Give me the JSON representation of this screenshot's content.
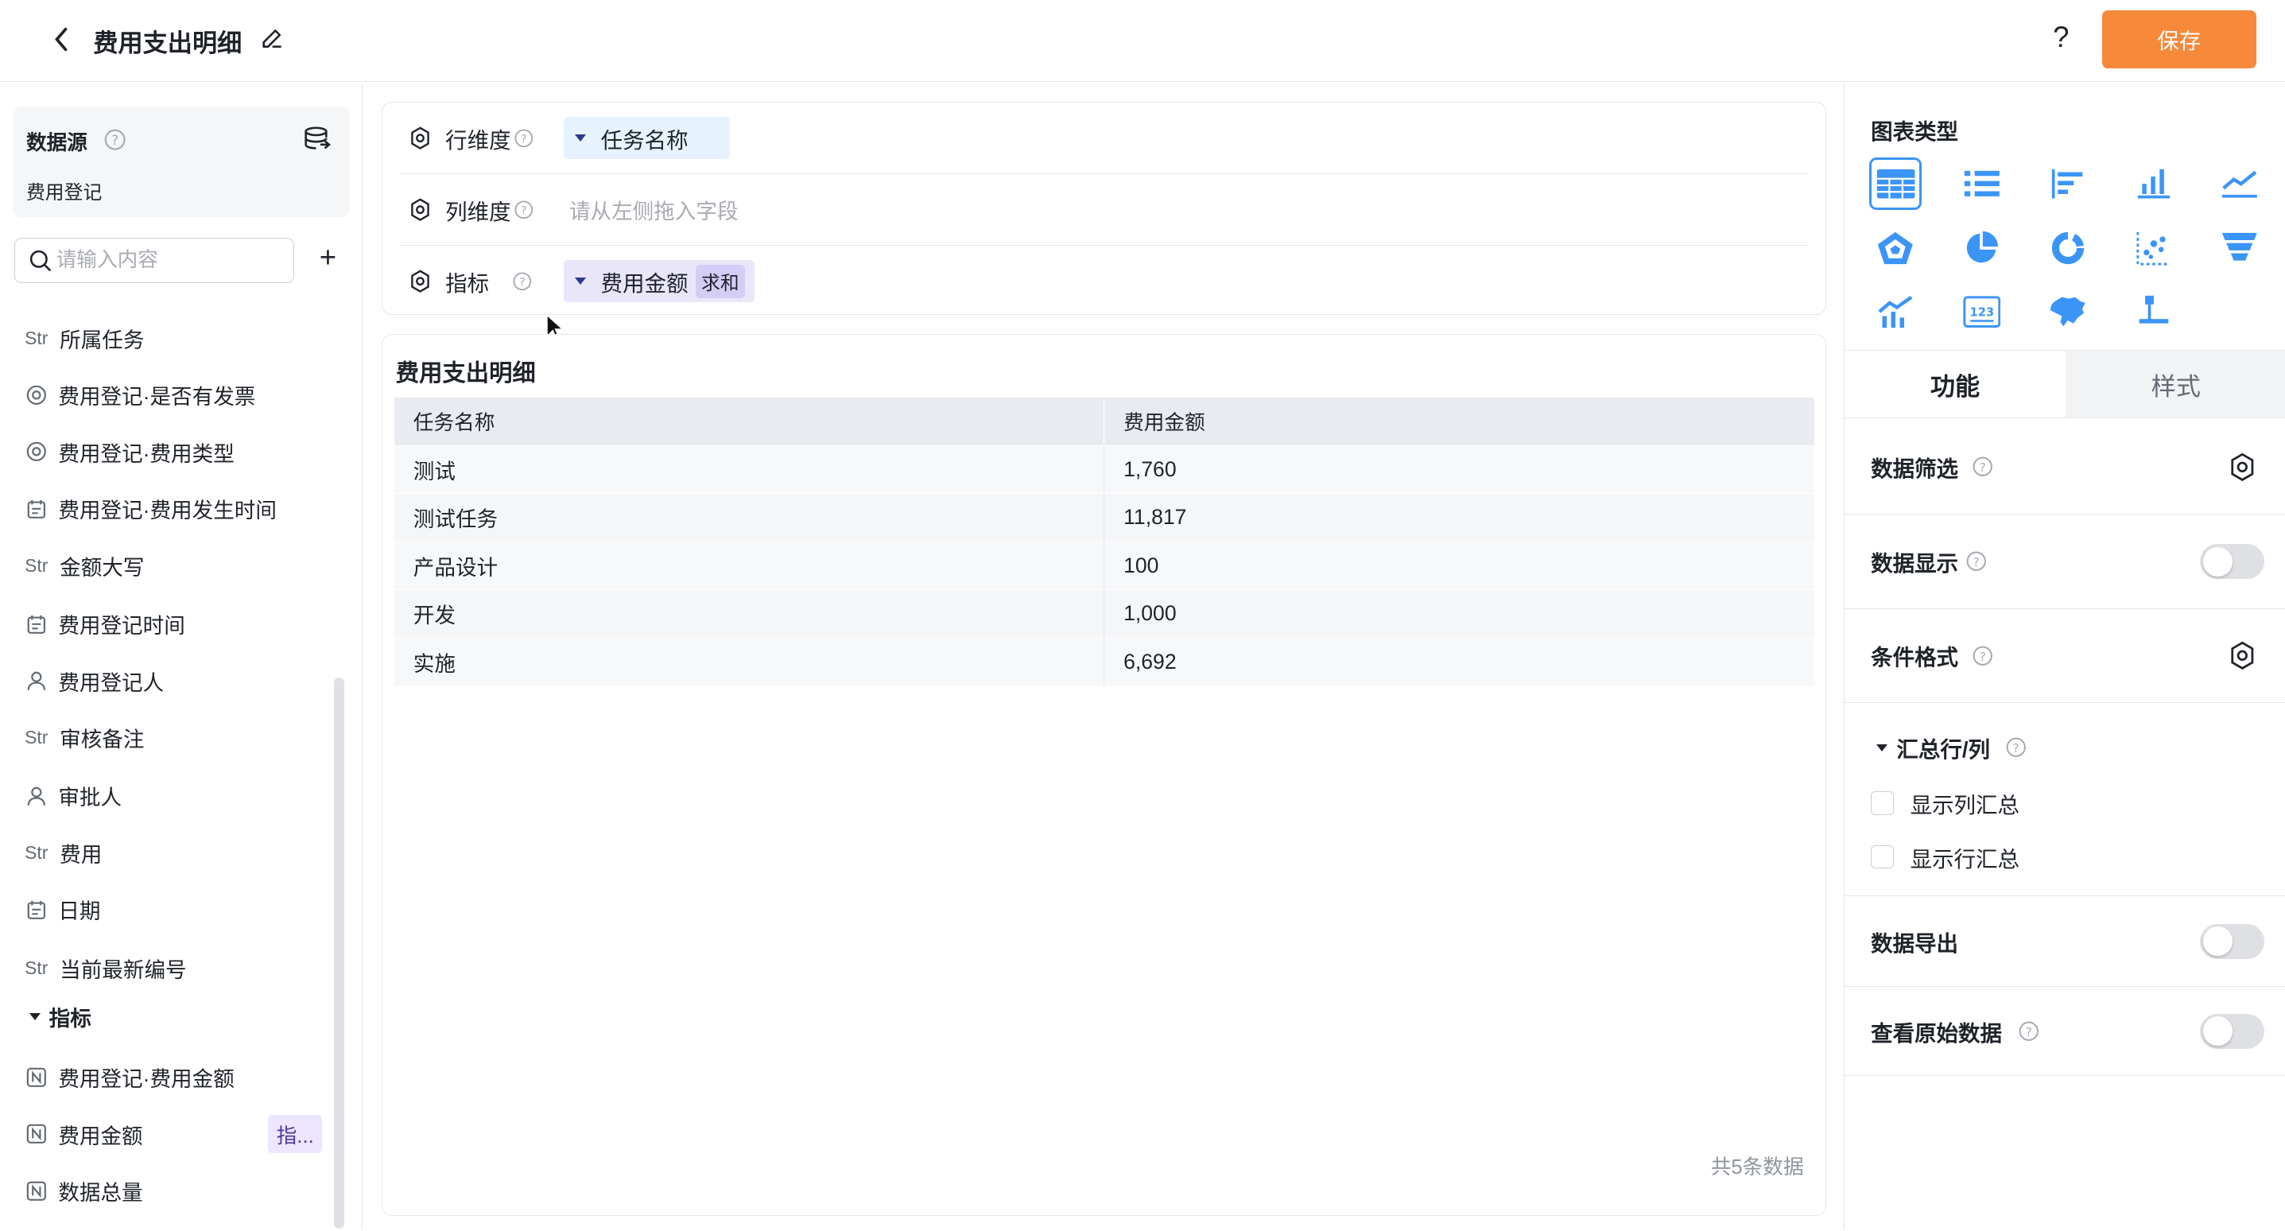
{
  "header": {
    "title": "费用支出明细",
    "save_label": "保存",
    "help_label": "?"
  },
  "sidebar": {
    "datasource_title": "数据源",
    "datasource_name": "费用登记",
    "search_placeholder": "请输入内容",
    "fields": [
      {
        "type": "Str",
        "label": "所属任务"
      },
      {
        "type": "option",
        "label": "费用登记·是否有发票"
      },
      {
        "type": "option",
        "label": "费用登记·费用类型"
      },
      {
        "type": "date",
        "label": "费用登记·费用发生时间"
      },
      {
        "type": "Str",
        "label": "金额大写"
      },
      {
        "type": "date",
        "label": "费用登记时间"
      },
      {
        "type": "user",
        "label": "费用登记人"
      },
      {
        "type": "Str",
        "label": "审核备注"
      },
      {
        "type": "user",
        "label": "审批人"
      },
      {
        "type": "Str",
        "label": "费用"
      },
      {
        "type": "date",
        "label": "日期"
      },
      {
        "type": "Str",
        "label": "当前最新编号"
      }
    ],
    "metrics_group": "指标",
    "metrics": [
      {
        "type": "number",
        "label": "费用登记·费用金额"
      },
      {
        "type": "number",
        "label": "费用金额",
        "tag": "指..."
      },
      {
        "type": "number",
        "label": "数据总量"
      }
    ]
  },
  "config": {
    "row_dim_label": "行维度",
    "row_dim_value": "任务名称",
    "col_dim_label": "列维度",
    "col_dim_placeholder": "请从左侧拖入字段",
    "metric_label": "指标",
    "metric_value": "费用金额",
    "metric_agg": "求和"
  },
  "result": {
    "title": "费用支出明细",
    "columns": [
      "任务名称",
      "费用金额"
    ],
    "rows": [
      [
        "测试",
        "1,760"
      ],
      [
        "测试任务",
        "11,817"
      ],
      [
        "产品设计",
        "100"
      ],
      [
        "开发",
        "1,000"
      ],
      [
        "实施",
        "6,692"
      ]
    ],
    "total": "共5条数据"
  },
  "right_panel": {
    "chart_type_title": "图表类型",
    "chart_types": [
      "table-icon",
      "list-icon",
      "bar-horizontal-icon",
      "bar-vertical-icon",
      "line-icon",
      "radar-icon",
      "pie-icon",
      "donut-icon",
      "scatter-icon",
      "funnel-icon",
      "combo-icon",
      "number-card-icon",
      "map-icon",
      "tree-icon"
    ],
    "tabs": [
      "功能",
      "样式"
    ],
    "options": {
      "filter": "数据筛选",
      "display": "数据显示",
      "conditional": "条件格式",
      "summary_group": "汇总行/列",
      "show_col_summary": "显示列汇总",
      "show_row_summary": "显示行汇总",
      "export": "数据导出",
      "raw_data": "查看原始数据"
    }
  },
  "colors": {
    "accent": "#f7893a",
    "active_chart_border": "#3b95f7",
    "row_chip": "#e6f3fe",
    "metric_chip": "#e9e6fa"
  }
}
